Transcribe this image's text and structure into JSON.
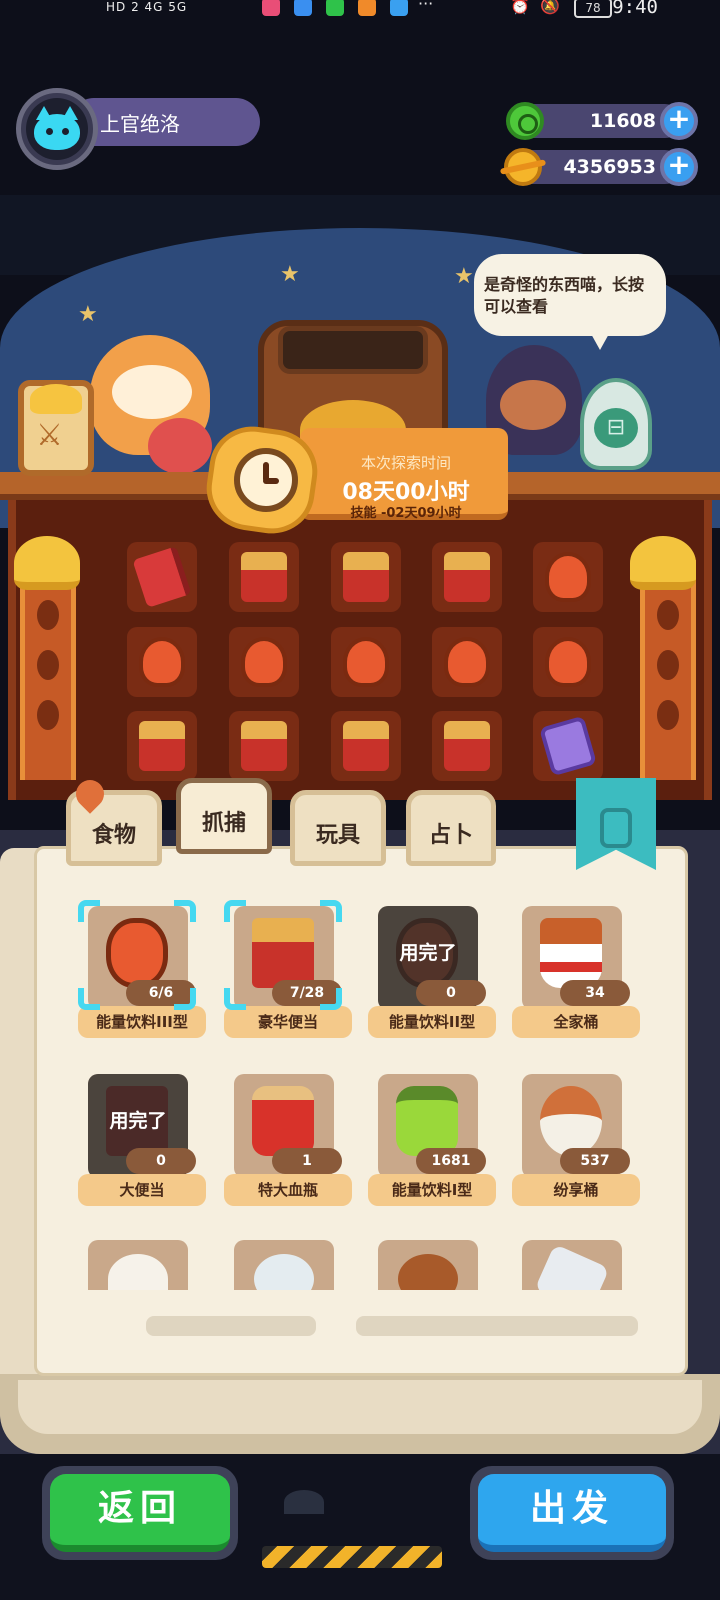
{
  "status_bar": {
    "left_indicators": "HD 2  4G  5G",
    "battery": "78",
    "time": "9:40",
    "overflow": "···"
  },
  "player": {
    "name": "上官绝洛"
  },
  "currency": {
    "green_coin": "11608",
    "gold_coin": "4356953",
    "add_symbol": "+"
  },
  "hint": {
    "text": "是奇怪的东西喵，长按可以查看"
  },
  "exploration": {
    "label": "本次探索时间",
    "time": "08天00小时",
    "skill": "技能 -02天09小时"
  },
  "shelf_grid": [
    [
      "book",
      "bento",
      "bento",
      "bento",
      "drink"
    ],
    [
      "drink",
      "drink",
      "drink",
      "drink",
      "drink"
    ],
    [
      "bento",
      "bento",
      "bento",
      "bento",
      "card"
    ]
  ],
  "tabs": [
    {
      "label": "食物",
      "active": false
    },
    {
      "label": "抓捕",
      "active": true
    },
    {
      "label": "玩具",
      "active": false
    },
    {
      "label": "占卜",
      "active": false
    }
  ],
  "items": [
    {
      "name": "能量饮料III型",
      "count": "6/6",
      "icon": "drink",
      "selected": true,
      "used_up": false
    },
    {
      "name": "豪华便当",
      "count": "7/28",
      "icon": "bento",
      "selected": true,
      "used_up": false
    },
    {
      "name": "能量饮料II型",
      "count": "0",
      "icon": "drink",
      "selected": false,
      "used_up": true
    },
    {
      "name": "全家桶",
      "count": "34",
      "icon": "bucket",
      "selected": false,
      "used_up": false
    },
    {
      "name": "大便当",
      "count": "0",
      "icon": "box2",
      "selected": false,
      "used_up": true
    },
    {
      "name": "特大血瓶",
      "count": "1",
      "icon": "bottle-red",
      "selected": false,
      "used_up": false
    },
    {
      "name": "能量饮料I型",
      "count": "1681",
      "icon": "bottle-green",
      "selected": false,
      "used_up": false
    },
    {
      "name": "纷享桶",
      "count": "537",
      "icon": "fan",
      "selected": false,
      "used_up": false
    }
  ],
  "used_up_label": "用完了",
  "partial_row_icons": [
    "rice",
    "jar",
    "leg",
    "tube"
  ],
  "buttons": {
    "back": "返回",
    "go": "出发"
  },
  "colors": {
    "selection": "#46d8f0",
    "back_button": "#2fc24a",
    "go_button": "#2ea6ee"
  }
}
